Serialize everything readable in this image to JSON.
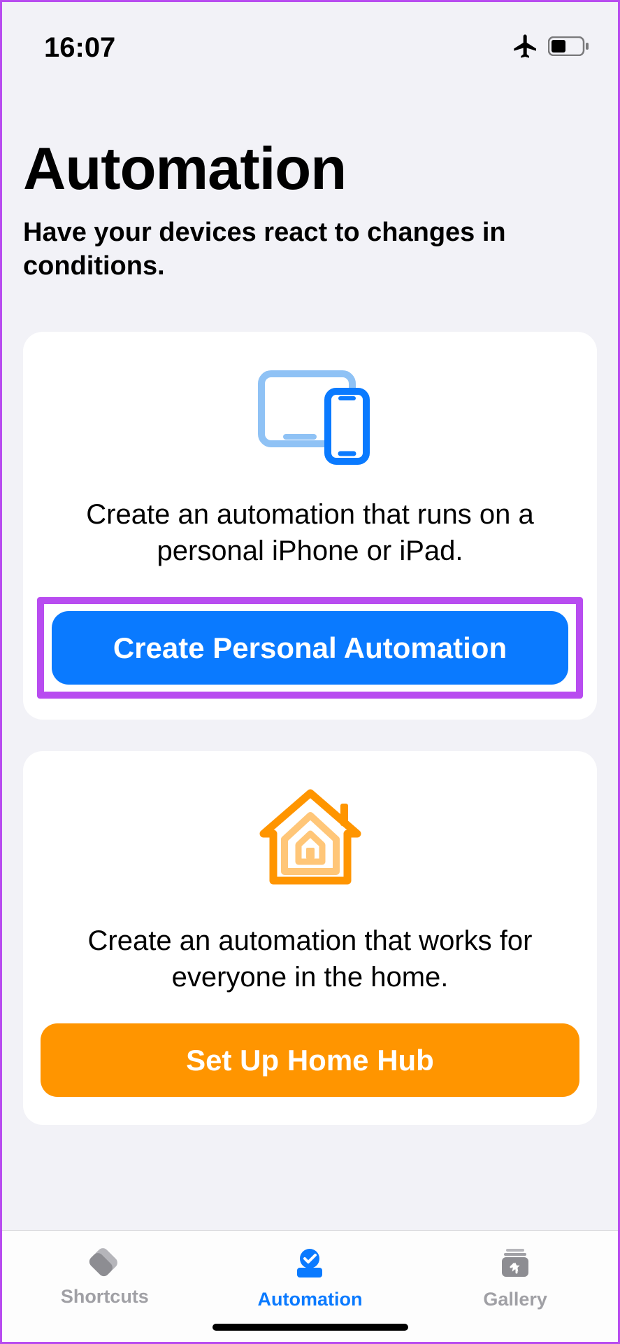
{
  "status": {
    "time": "16:07"
  },
  "header": {
    "title": "Automation",
    "subtitle": "Have your devices react to changes in conditions."
  },
  "cards": {
    "personal": {
      "description": "Create an automation that runs on a personal iPhone or iPad.",
      "button": "Create Personal Automation"
    },
    "home": {
      "description": "Create an automation that works for everyone in the home.",
      "button": "Set Up Home Hub"
    }
  },
  "tabs": {
    "shortcuts": "Shortcuts",
    "automation": "Automation",
    "gallery": "Gallery"
  }
}
